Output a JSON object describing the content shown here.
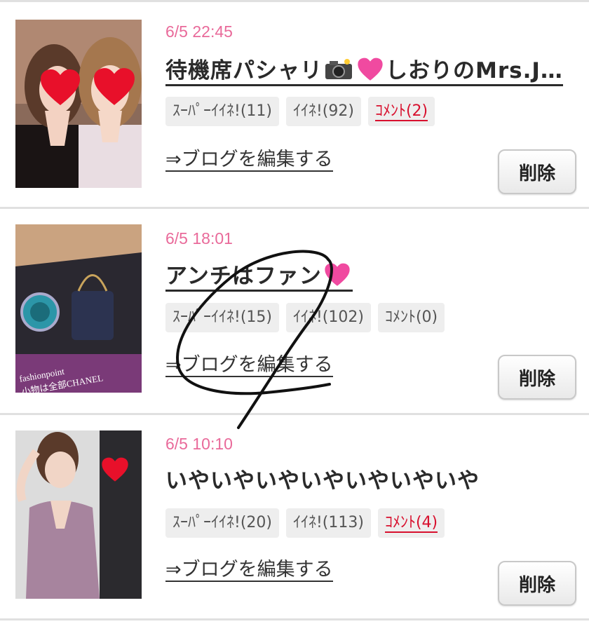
{
  "entries": [
    {
      "date": "6/5 22:45",
      "title": "待機席パシャリ",
      "title_suffix": "しおりのMrs.J…",
      "tags": [
        "ｽｰﾊﾟｰｲｲﾈ!(11)",
        "ｲｲﾈ!(92)",
        "ｺﾒﾝﾄ(2)"
      ],
      "edit_label": "⇒ブログを編集する",
      "delete_label": "削除"
    },
    {
      "date": "6/5 18:01",
      "title": "アンチはファン",
      "tags": [
        "ｽｰﾊﾟｰｲｲﾈ!(15)",
        "ｲｲﾈ!(102)",
        "ｺﾒﾝﾄ(0)"
      ],
      "edit_label": "⇒ブログを編集する",
      "delete_label": "削除",
      "thumb_caption_1": "fashionpoint",
      "thumb_caption_2": "小物は全部CHANEL"
    },
    {
      "date": "6/5 10:10",
      "title": "いやいやいやいやいやいやいや",
      "tags": [
        "ｽｰﾊﾟｰｲｲﾈ!(20)",
        "ｲｲﾈ!(113)",
        "ｺﾒﾝﾄ(4)"
      ],
      "edit_label": "⇒ブログを編集する",
      "delete_label": "削除"
    }
  ],
  "colors": {
    "date": "#e96a9a",
    "comment_active": "#d8102e",
    "heart": "#e8102a",
    "pink_heart": "#f04aa0"
  }
}
